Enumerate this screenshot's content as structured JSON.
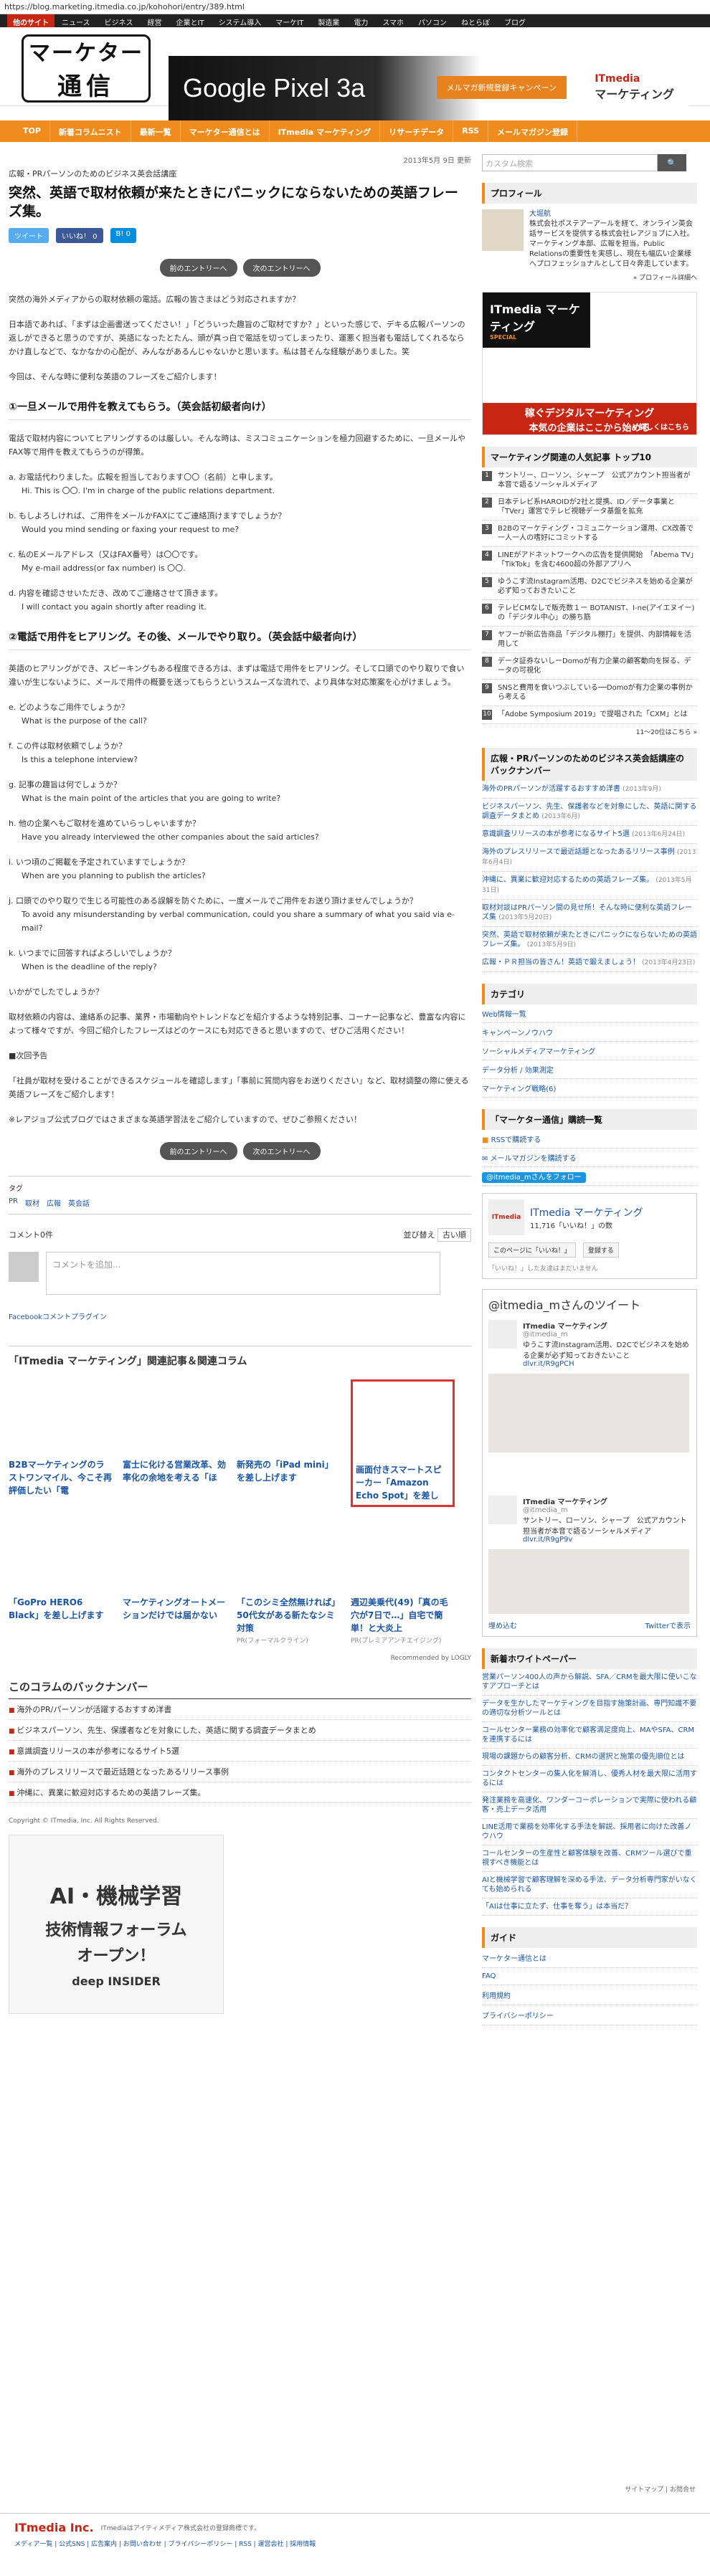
{
  "url": "https://blog.marketing.itmedia.co.jp/kohohori/entry/389.html",
  "topnav": {
    "brand": "他のサイト",
    "items": [
      "ニュース",
      "ビジネス",
      "経営",
      "企業とIT",
      "システム導入",
      "マーケIT",
      "製造業",
      "電力",
      "スマホ",
      "パソコン",
      "ねとらぼ",
      "ブログ"
    ]
  },
  "header": {
    "logo_line1": "マーケター",
    "logo_line2": "通信",
    "ad_title": "Google Pixel 3a",
    "ad_sub": "が 当たる",
    "ad_button": "メルマガ新規登録キャンペーン",
    "ad_brand": "ITmedia",
    "ad_brand_sub": "マーケティング"
  },
  "catnav": [
    "TOP",
    "新着コラムニスト",
    "最新一覧",
    "マーケター通信とは",
    "ITmedia マーケティング",
    "リサーチデータ",
    "RSS",
    "メールマガジン登録"
  ],
  "article": {
    "date": "2013年5月 9日 更新",
    "category": "広報・PRパーソンのためのビジネス英会話講座",
    "title": "突然、英語で取材依頼が来たときにパニックにならないための英語フレーズ集。",
    "share": {
      "tweet": "ツイート",
      "like": "いいね！ 0",
      "hatena": "B! 0"
    },
    "pager_prev": "前のエントリーへ",
    "pager_next": "次のエントリーへ",
    "intro": "突然の海外メディアからの取材依頼の電話。広報の皆さまはどう対応されますか？",
    "p1": "日本語であれば、「まずは企画書送ってください！」「どういった趣旨のご取材ですか？」といった感じで、デキる広報パーソンの返しができると思うのですが、英語になったとたん、頭が真っ白で電話を切ってしまったり、運悪く担当者も電話してくれるならかけ直しなどで、なかなかの心配が、みんながあるんじゃないかと思います。私は昔そんな経験がありました。笑",
    "p2": "今回は、そんな時に便利な英語のフレーズをご紹介します！",
    "sec1": "①一旦メールで用件を教えてもらう。（英会話初級者向け）",
    "sec1_intro": "電話で取材内容についてヒアリングするのは厳しい。そんな時は、ミスコミュニケーションを極力回避するために、一旦メールやFAX等で用件を教えてもらうのが得策。",
    "qa1": [
      {
        "jp": "a. お電話代わりました。広報を担当しております〇〇（名前）と申します。",
        "en": "Hi. This is 〇〇. I'm in charge of the public relations department."
      },
      {
        "jp": "b. もしよろしければ、ご用件をメールかFAXにてご連絡頂けますでしょうか？",
        "en": "Would you mind sending or faxing your request to me?"
      },
      {
        "jp": "c. 私のEメールアドレス（又はFAX番号）は〇〇です。",
        "en": "My e-mail address(or fax number) is 〇〇."
      },
      {
        "jp": "d. 内容を確認させいただき、改めてご連絡させて頂きます。",
        "en": "I will contact you again shortly after reading it."
      }
    ],
    "sec2": "②電話で用件をヒアリング。その後、メールでやり取り。（英会話中級者向け）",
    "sec2_intro": "英語のヒアリングができ、スピーキングもある程度できる方は、まずは電話で用件をヒアリング。そして口頭でのやり取りで食い違いが生じないように、メールで用件の概要を送ってもらうというスムーズな流れで、より具体な対応策案を心がけましょう。",
    "qa2": [
      {
        "jp": "e. どのようなご用件でしょうか？",
        "en": "What is the purpose of the call?"
      },
      {
        "jp": "f. この件は取材依頼でしょうか？",
        "en": "Is this a telephone interview?"
      },
      {
        "jp": "g. 記事の趣旨は何でしょうか？",
        "en": "What is the main point of the articles that you are going to write?"
      },
      {
        "jp": "h. 他の企業へもご取材を進めていらっしゃいますか？",
        "en": "Have you already interviewed the other companies about the said articles?"
      },
      {
        "jp": "i. いつ頃のご掲載を予定されていますでしょうか？",
        "en": "When are you planning to publish the articles?"
      },
      {
        "jp": "j. 口頭でのやり取りで生じる可能性のある誤解を防ぐために、一度メールでご用件をお送り頂けませんでしょうか？",
        "en": "To avoid any misunderstanding by verbal communication, could you share a summary of what you said via e-mail?"
      },
      {
        "jp": "k. いつまでに回答すればよろしいでしょうか？",
        "en": "When is the deadline of the reply?"
      }
    ],
    "p3": "いかがでしたでしょうか？",
    "p4": "取材依頼の内容は、連絡系の記事、業界・市場動向やトレンドなどを紹介するような特別記事、コーナー記事など、豊富な内容によって様々ですが、今回ご紹介したフレーズはどのケースにも対応できると思いますので、ぜひご活用ください！",
    "next_h": "■次回予告",
    "p5": "「社員が取材を受けることができるスケジュールを確認します」「事前に質問内容をお送りください」など、取材調整の際に使える英語フレーズをご紹介します！",
    "p6": "※レアジョブ公式ブログではさまざまな英語学習法をご紹介していますので、ぜひご参照ください！",
    "tag_label": "タグ",
    "tags": [
      "PR",
      "取材",
      "広報",
      "英会話"
    ]
  },
  "comments": {
    "count": "コメント0件",
    "sort_label": "並び替え",
    "sort_value": "古い順",
    "placeholder": "コメントを追加...",
    "plugin": "Facebookコメントプラグイン"
  },
  "related": {
    "title": "「ITmedia マーケティング」関連記事＆関連コラム",
    "items": [
      {
        "text": "B2Bマーケティングのラストワンマイル、今こそ再評価したい「電",
        "sub": ""
      },
      {
        "text": "富士に化ける営業改革、効率化の余地を考える「ほ",
        "sub": ""
      },
      {
        "text": "新発売の「iPad mini」を差し上げます",
        "sub": ""
      },
      {
        "text": "画面付きスマートスピーカー「Amazon Echo Spot」を差し",
        "sub": ""
      },
      {
        "text": "「GoPro HERO6 Black」を差し上げます",
        "sub": ""
      },
      {
        "text": "マーケティングオートメーションだけでは届かない",
        "sub": ""
      },
      {
        "text": "「このシミ全然無ければ」50代女がある新たなシミ対策",
        "sub": "PR(フォーマルクライン)"
      },
      {
        "text": "週辺美乗代(49)「真の毛穴が7日で…」自宅で簡単！と大炎上",
        "sub": "PR(プレミアアンチエイジング)"
      }
    ],
    "recommended": "Recommended by LOGLY"
  },
  "backnumber": {
    "title": "このコラムのバックナンバー",
    "items": [
      "海外のPR/パーソンが活躍するおすすめ洋書",
      "ビジネスパーソン、先生、保護者などを対象にした、英語に関する調査データまとめ",
      "意識調査リリースの本が参考になるサイト5選",
      "海外のプレスリリースで最近話題となったあるリリース事例",
      "沖縄に、異業に歓迎対応するための英語フレーズ集。"
    ],
    "copyright": "Copyright © ITmedia, Inc. All Rights Reserved."
  },
  "ai_banner": {
    "line1": "AI・機械学習",
    "line2": "技術情報フォーラム",
    "line3": "オープン！",
    "line4": "deep INSIDER"
  },
  "sidebar": {
    "search_placeholder": "カスタム検索",
    "profile_title": "プロフィール",
    "profile_name": "大堀航",
    "profile_text": "株式会社ポステアーアールを経て、オンライン英会話サービスを提供する株式会社レアジョブに入社。マーケティング本部、広報を担当。Public Relationsの重要性を実感し、現在も幅広い企業様へプロフェッショナルとして日々奔走しています。",
    "profile_more": "» プロフィール詳細へ",
    "mk_ad_title": "ITmedia マーケティング",
    "mk_ad_special": "SPECIAL",
    "mk_ad_bottom1": "稼ぐデジタルマーケティング",
    "mk_ad_bottom2": "本気の企業はここから始める",
    "mk_ad_more": "» 詳しくはこちら",
    "rank_title": "マーケティング関連の人気記事 トップ10",
    "ranking": [
      "サントリー、ローソン、シャープ　公式アカウント担当者が本音で語るソーシャルメディア",
      "日本テレビ系HAROIDが2社と提携、ID／データ事業と「TVer」運営でテレビ視聴データ基盤を拡充",
      "B2Bのマーケティング・コミュニケーション運用、CX改善で一人一人の嗜好にコミットする",
      "LINEがアドネットワークへの広告を提供開始　「Abema TV」「TikTok」を含む4600超の外部アプリへ",
      "ゆうこす流Instagram活用、D2Cでビジネスを始める企業が必ず知っておきたいこと",
      "テレビCMなしで販売数１ー BOTANIST、I-ne(アイエヌイー)の「デジタル中心」の勝ち筋",
      "ヤフーが新広告商品「デジタル棚打」を提供、内部情報を活用して",
      "データ証券ないしーDomoが有力企業の顧客動向を探る、データの可視化",
      "SNSと費用を食いつぶしている──Domoが有力企業の事例から考える",
      "「Adobe Symposium 2019」で提唱された「CXM」とは"
    ],
    "rank_more": "11〜20位はこちら »",
    "back_title": "広報・PRパーソンのためのビジネス英会話講座のバックナンバー",
    "back_items": [
      {
        "t": "海外のPRパーソンが活躍するおすすめ洋書",
        "d": "(2013年9月)"
      },
      {
        "t": "ビジネスパーソン、先生、保護者などを対象にした、英語に関する調査データまとめ",
        "d": "(2013年6月)"
      },
      {
        "t": "意識調査リリースの本が参考になるサイト5選",
        "d": "(2013年6月24日)"
      },
      {
        "t": "海外のプレスリリースで最近話題となったあるリリース事例",
        "d": "(2013年6月4日)"
      },
      {
        "t": "沖縄に、異業に歓迎対応するための英語フレーズ集。",
        "d": "(2013年5月31日)"
      },
      {
        "t": "取材対談はPRパーソン間の見せ所！そんな時に便利な英語フレーズ集",
        "d": "(2013年5月20日)"
      },
      {
        "t": "突然、英語で取材依頼が来たときにパニックにならないための英語フレーズ集。",
        "d": "(2013年5月9日)"
      },
      {
        "t": "広報・ＰＲ担当の皆さん！英語で鍛えましょう！",
        "d": "(2013年4月23日)"
      }
    ],
    "cat_title": "カテゴリ",
    "categories": [
      "Web情報一覧",
      "キャンペーンノウハウ",
      "ソーシャルメディアマーケティング",
      "データ分析 / 効果測定",
      "マーケティング戦略(6)"
    ],
    "reader_title": "「マーケター通信」購読一覧",
    "reader_items": [
      "RSSで購読する",
      "メールマガジンを購読する",
      "@itmedia_mさんをフォロー"
    ],
    "fb_name": "ITmedia マーケティング",
    "fb_likes": "11,716「いいね！」の数",
    "fb_btn1": "このページに「いいね！」",
    "fb_btn2": "登録する",
    "fb_note": "「いいね！」した友達はまだいません",
    "tw_title": "@itmedia_mさんのツイート",
    "tw_name": "ITmedia マーケティング",
    "tw_handle": "@itmedia_m",
    "tw_text": "ゆうこす流Instagram活用、D2Cでビジネスを始める企業が必ず知っておきたいこと",
    "tw_link": "dlvr.it/R9gPCH",
    "tw_text2": "サントリー、ローソン、シャープ　公式アカウント担当者が本音で語るソーシャルメディア",
    "tw_link2": "dlvr.it/R9gP9v",
    "tw_embed": "埋め込む",
    "tw_view": "Twitterで表示",
    "wp_title": "新着ホワイトペーパー",
    "wp_items": [
      "営業パーソン400人の声から解説、SFA／CRMを最大限に使いこなすアプローチとは",
      "データを生かしたマーケティングを目指す施策計画、専門知識不要の適切な分析ツールとは",
      "コールセンター業務の効率化で顧客満足度向上、MAやSFA、CRMを連携するには",
      "現場の課題からの顧客分析、CRMの選択と施策の優先順位とは",
      "コンタクトセンターの集人化を解消し、優秀人材を最大限に活用するには",
      "発注業務を高速化、ワンダーコーポレーションで実際に使われる顧客・売上データ活用",
      "LINE活用で業務を効率化する手法を解説、採用者に向けた改善ノウハウ",
      "コールセンターの生産性と顧客体験を改善、CRMツール選びで重視すべき機能とは",
      "AIと機械学習で顧客理解を深める手法、データ分析専門家がいなくても始められる",
      "「AIは仕事に立たず、仕事を奪う」は本当だ？"
    ],
    "guide_title": "ガイド",
    "guide_items": [
      "マーケター通信とは",
      "FAQ",
      "利用規約",
      "プライバシーポリシー"
    ]
  },
  "footer": {
    "sitemap": "サイトマップ | お問合せ",
    "brand": "ITmedia Inc.",
    "desc": "ITmediaはアイティメディア株式会社の登録商標です。",
    "links": "メディア一覧 | 公式SNS | 広告案内 | お問い合わせ | プライバシーポリシー | RSS | 運営会社 | 採用情報"
  }
}
